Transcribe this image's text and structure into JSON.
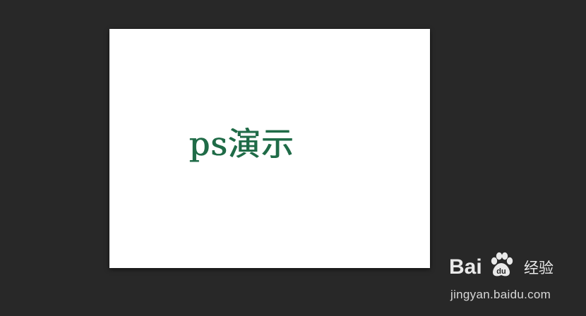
{
  "canvas": {
    "text": "ps演示",
    "text_color": "#1f6b47",
    "background_color": "#ffffff"
  },
  "workspace": {
    "background_color": "#282828"
  },
  "watermark": {
    "brand_left": "Bai",
    "brand_icon": "paw-icon",
    "brand_right": "du",
    "product": "经验",
    "url": "jingyan.baidu.com"
  }
}
